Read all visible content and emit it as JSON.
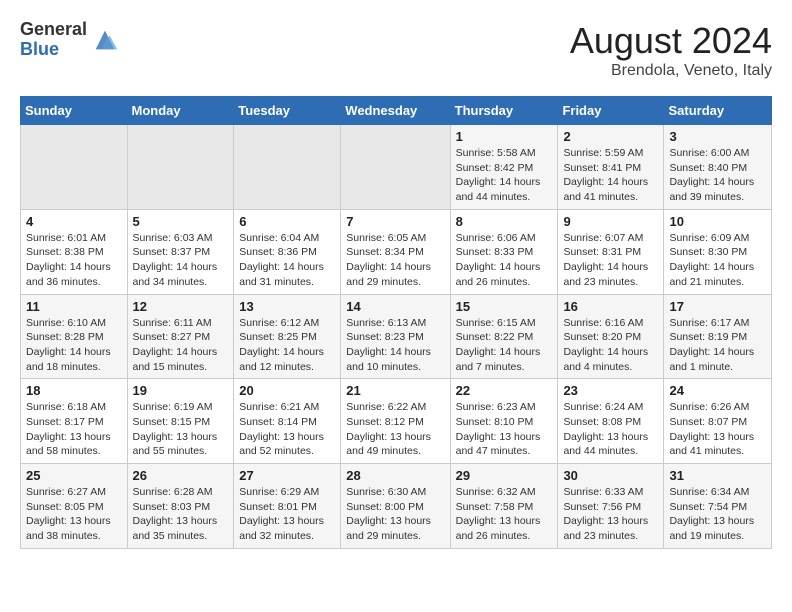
{
  "header": {
    "logo_general": "General",
    "logo_blue": "Blue",
    "month_title": "August 2024",
    "subtitle": "Brendola, Veneto, Italy"
  },
  "days_of_week": [
    "Sunday",
    "Monday",
    "Tuesday",
    "Wednesday",
    "Thursday",
    "Friday",
    "Saturday"
  ],
  "weeks": [
    [
      {
        "day": "",
        "sunrise": "",
        "sunset": "",
        "daylight": ""
      },
      {
        "day": "",
        "sunrise": "",
        "sunset": "",
        "daylight": ""
      },
      {
        "day": "",
        "sunrise": "",
        "sunset": "",
        "daylight": ""
      },
      {
        "day": "",
        "sunrise": "",
        "sunset": "",
        "daylight": ""
      },
      {
        "day": "1",
        "sunrise": "Sunrise: 5:58 AM",
        "sunset": "Sunset: 8:42 PM",
        "daylight": "Daylight: 14 hours and 44 minutes."
      },
      {
        "day": "2",
        "sunrise": "Sunrise: 5:59 AM",
        "sunset": "Sunset: 8:41 PM",
        "daylight": "Daylight: 14 hours and 41 minutes."
      },
      {
        "day": "3",
        "sunrise": "Sunrise: 6:00 AM",
        "sunset": "Sunset: 8:40 PM",
        "daylight": "Daylight: 14 hours and 39 minutes."
      }
    ],
    [
      {
        "day": "4",
        "sunrise": "Sunrise: 6:01 AM",
        "sunset": "Sunset: 8:38 PM",
        "daylight": "Daylight: 14 hours and 36 minutes."
      },
      {
        "day": "5",
        "sunrise": "Sunrise: 6:03 AM",
        "sunset": "Sunset: 8:37 PM",
        "daylight": "Daylight: 14 hours and 34 minutes."
      },
      {
        "day": "6",
        "sunrise": "Sunrise: 6:04 AM",
        "sunset": "Sunset: 8:36 PM",
        "daylight": "Daylight: 14 hours and 31 minutes."
      },
      {
        "day": "7",
        "sunrise": "Sunrise: 6:05 AM",
        "sunset": "Sunset: 8:34 PM",
        "daylight": "Daylight: 14 hours and 29 minutes."
      },
      {
        "day": "8",
        "sunrise": "Sunrise: 6:06 AM",
        "sunset": "Sunset: 8:33 PM",
        "daylight": "Daylight: 14 hours and 26 minutes."
      },
      {
        "day": "9",
        "sunrise": "Sunrise: 6:07 AM",
        "sunset": "Sunset: 8:31 PM",
        "daylight": "Daylight: 14 hours and 23 minutes."
      },
      {
        "day": "10",
        "sunrise": "Sunrise: 6:09 AM",
        "sunset": "Sunset: 8:30 PM",
        "daylight": "Daylight: 14 hours and 21 minutes."
      }
    ],
    [
      {
        "day": "11",
        "sunrise": "Sunrise: 6:10 AM",
        "sunset": "Sunset: 8:28 PM",
        "daylight": "Daylight: 14 hours and 18 minutes."
      },
      {
        "day": "12",
        "sunrise": "Sunrise: 6:11 AM",
        "sunset": "Sunset: 8:27 PM",
        "daylight": "Daylight: 14 hours and 15 minutes."
      },
      {
        "day": "13",
        "sunrise": "Sunrise: 6:12 AM",
        "sunset": "Sunset: 8:25 PM",
        "daylight": "Daylight: 14 hours and 12 minutes."
      },
      {
        "day": "14",
        "sunrise": "Sunrise: 6:13 AM",
        "sunset": "Sunset: 8:23 PM",
        "daylight": "Daylight: 14 hours and 10 minutes."
      },
      {
        "day": "15",
        "sunrise": "Sunrise: 6:15 AM",
        "sunset": "Sunset: 8:22 PM",
        "daylight": "Daylight: 14 hours and 7 minutes."
      },
      {
        "day": "16",
        "sunrise": "Sunrise: 6:16 AM",
        "sunset": "Sunset: 8:20 PM",
        "daylight": "Daylight: 14 hours and 4 minutes."
      },
      {
        "day": "17",
        "sunrise": "Sunrise: 6:17 AM",
        "sunset": "Sunset: 8:19 PM",
        "daylight": "Daylight: 14 hours and 1 minute."
      }
    ],
    [
      {
        "day": "18",
        "sunrise": "Sunrise: 6:18 AM",
        "sunset": "Sunset: 8:17 PM",
        "daylight": "Daylight: 13 hours and 58 minutes."
      },
      {
        "day": "19",
        "sunrise": "Sunrise: 6:19 AM",
        "sunset": "Sunset: 8:15 PM",
        "daylight": "Daylight: 13 hours and 55 minutes."
      },
      {
        "day": "20",
        "sunrise": "Sunrise: 6:21 AM",
        "sunset": "Sunset: 8:14 PM",
        "daylight": "Daylight: 13 hours and 52 minutes."
      },
      {
        "day": "21",
        "sunrise": "Sunrise: 6:22 AM",
        "sunset": "Sunset: 8:12 PM",
        "daylight": "Daylight: 13 hours and 49 minutes."
      },
      {
        "day": "22",
        "sunrise": "Sunrise: 6:23 AM",
        "sunset": "Sunset: 8:10 PM",
        "daylight": "Daylight: 13 hours and 47 minutes."
      },
      {
        "day": "23",
        "sunrise": "Sunrise: 6:24 AM",
        "sunset": "Sunset: 8:08 PM",
        "daylight": "Daylight: 13 hours and 44 minutes."
      },
      {
        "day": "24",
        "sunrise": "Sunrise: 6:26 AM",
        "sunset": "Sunset: 8:07 PM",
        "daylight": "Daylight: 13 hours and 41 minutes."
      }
    ],
    [
      {
        "day": "25",
        "sunrise": "Sunrise: 6:27 AM",
        "sunset": "Sunset: 8:05 PM",
        "daylight": "Daylight: 13 hours and 38 minutes."
      },
      {
        "day": "26",
        "sunrise": "Sunrise: 6:28 AM",
        "sunset": "Sunset: 8:03 PM",
        "daylight": "Daylight: 13 hours and 35 minutes."
      },
      {
        "day": "27",
        "sunrise": "Sunrise: 6:29 AM",
        "sunset": "Sunset: 8:01 PM",
        "daylight": "Daylight: 13 hours and 32 minutes."
      },
      {
        "day": "28",
        "sunrise": "Sunrise: 6:30 AM",
        "sunset": "Sunset: 8:00 PM",
        "daylight": "Daylight: 13 hours and 29 minutes."
      },
      {
        "day": "29",
        "sunrise": "Sunrise: 6:32 AM",
        "sunset": "Sunset: 7:58 PM",
        "daylight": "Daylight: 13 hours and 26 minutes."
      },
      {
        "day": "30",
        "sunrise": "Sunrise: 6:33 AM",
        "sunset": "Sunset: 7:56 PM",
        "daylight": "Daylight: 13 hours and 23 minutes."
      },
      {
        "day": "31",
        "sunrise": "Sunrise: 6:34 AM",
        "sunset": "Sunset: 7:54 PM",
        "daylight": "Daylight: 13 hours and 19 minutes."
      }
    ]
  ]
}
